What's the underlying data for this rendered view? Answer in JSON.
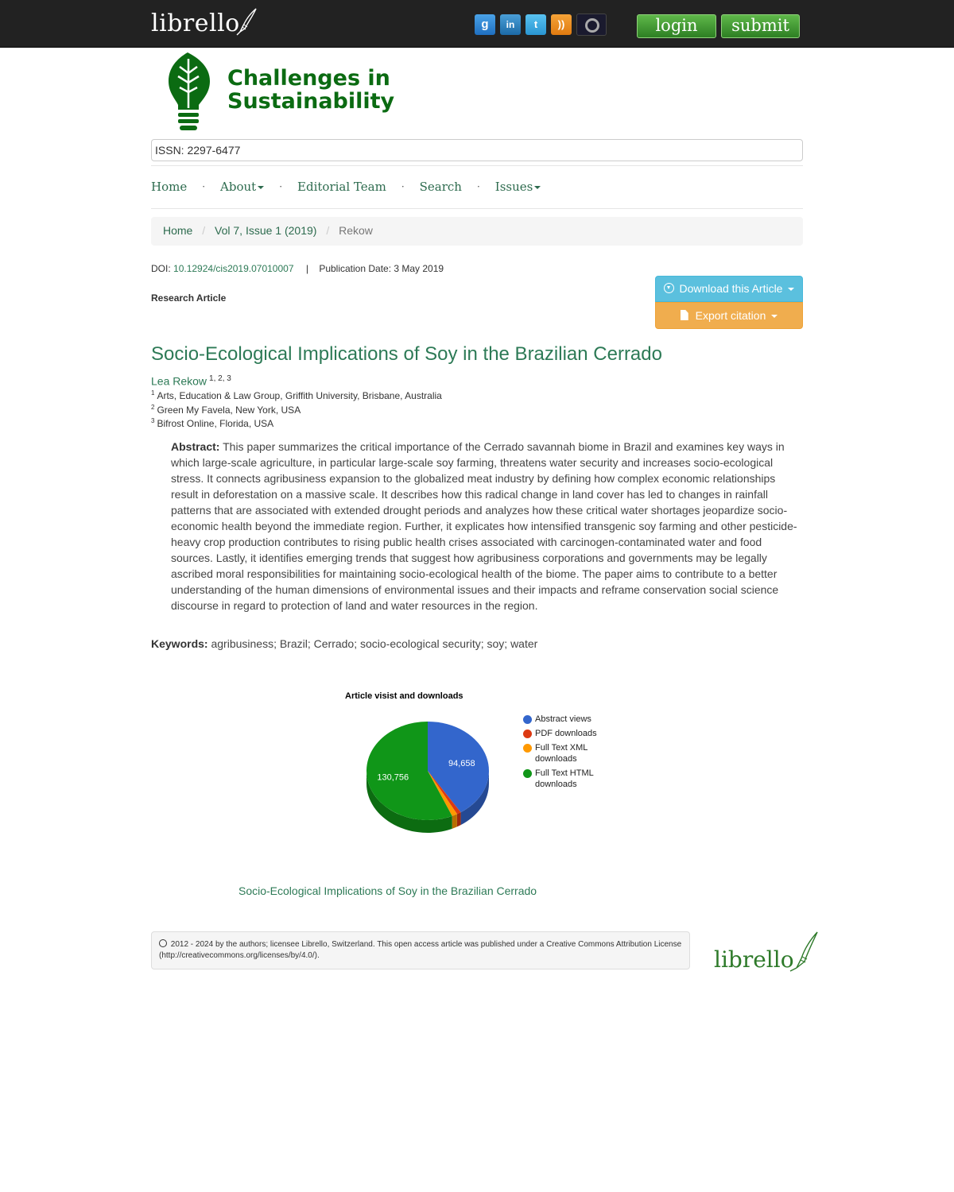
{
  "topbar": {
    "brand": "librello",
    "social_icons": [
      "google-plus-icon",
      "linkedin-icon",
      "twitter-icon",
      "rss-icon",
      "archive-icon"
    ],
    "google_glyph": "g",
    "linkedin_glyph": "in",
    "twitter_glyph": "t",
    "rss_glyph": "))",
    "login_label": "login",
    "submit_label": "submit"
  },
  "journal": {
    "title_line1": "Challenges in",
    "title_line2": "Sustainability",
    "issn": "ISSN: 2297-6477"
  },
  "nav": {
    "items": [
      {
        "label": "Home"
      },
      {
        "label": "About"
      },
      {
        "label": "Editorial Team"
      },
      {
        "label": "Search"
      },
      {
        "label": "Issues"
      }
    ],
    "separator": "·"
  },
  "breadcrumb": {
    "home": "Home",
    "issue": "Vol 7, Issue 1 (2019)",
    "current": "Rekow",
    "separator": "/"
  },
  "article": {
    "doi_label": "DOI:",
    "doi": "10.12924/cis2019.07010007",
    "pub_sep": "|",
    "publication_date": "Publication Date: 3 May 2019",
    "type": "Research Article",
    "download_label": "Download this Article",
    "export_label": "Export citation",
    "title": "Socio-Ecological Implications of Soy in the Brazilian Cerrado",
    "author": "Lea Rekow",
    "author_sup": "1, 2, 3",
    "affiliations": [
      {
        "num": "1",
        "text": "Arts, Education & Law Group, Griffith University, Brisbane, Australia"
      },
      {
        "num": "2",
        "text": "Green My Favela, New York, USA"
      },
      {
        "num": "3",
        "text": "Bifrost Online, Florida, USA"
      }
    ],
    "abstract_label": "Abstract:",
    "abstract": "This paper summarizes the critical importance of the Cerrado savannah biome in Brazil and examines key ways in which large-scale agriculture, in particular large-scale soy farming, threatens water security and increases socio-ecological stress. It connects agribusiness expansion to the globalized meat industry by defining how complex economic relationships result in deforestation on a massive scale. It describes how this radical change in land cover has led to changes in rainfall patterns that are associated with extended drought periods and analyzes how these critical water shortages jeopardize socio-economic health beyond the immediate region. Further, it explicates how intensified transgenic soy farming and other pesticide-heavy crop production contributes to rising public health crises associated with carcinogen-contaminated water and food sources. Lastly, it identifies emerging trends that suggest how agribusiness corporations and governments may be legally ascribed moral responsibilities for maintaining socio-ecological health of the biome. The paper aims to contribute to a better understanding of the human dimensions of environmental issues and their impacts and reframe conservation social science discourse in regard to protection of land and water resources in the region.",
    "keywords_label": "Keywords:",
    "keywords": "agribusiness; Brazil; Cerrado; socio-ecological security; soy; water",
    "bottom_link": "Socio-Ecological Implications of Soy in the Brazilian Cerrado"
  },
  "chart_data": {
    "type": "pie",
    "title": "Article visist and downloads",
    "legend_position": "right",
    "series": [
      {
        "name": "Abstract views",
        "value": 94658,
        "label": "94,658",
        "color": "#3366cc"
      },
      {
        "name": "PDF downloads",
        "value": 2600,
        "label": "",
        "color": "#dc3912"
      },
      {
        "name": "Full Text XML downloads",
        "value": 3300,
        "label": "",
        "color": "#ff9900"
      },
      {
        "name": "Full Text HTML downloads",
        "value": 130756,
        "label": "130,756",
        "color": "#109618"
      }
    ]
  },
  "footer": {
    "license": "2012 - 2024 by the authors; licensee Librello, Switzerland. This open access article was published under a Creative Commons Attribution License (http://creativecommons.org/licenses/by/4.0/).",
    "brand": "librello"
  }
}
